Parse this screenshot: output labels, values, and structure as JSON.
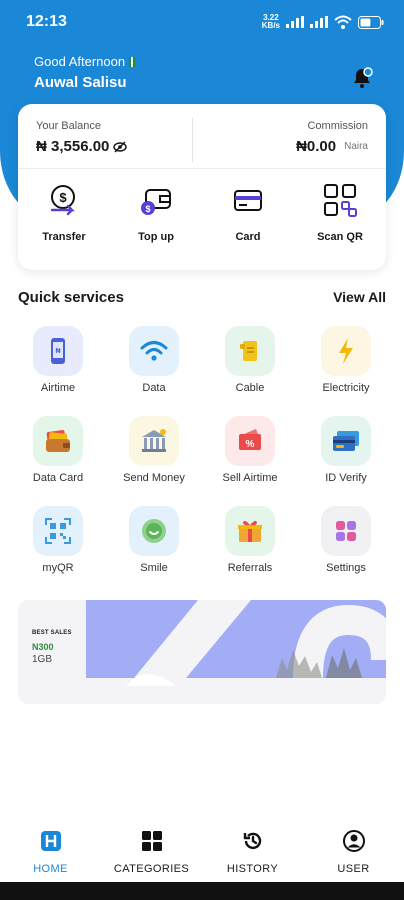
{
  "status_bar": {
    "time": "12:13",
    "net_speed_value": "3.22",
    "net_speed_unit": "KB/s",
    "battery_level": 0.55
  },
  "header": {
    "greeting": "Good Afternoon",
    "username": "Auwal Salisu",
    "accent_color": "#1a88d6"
  },
  "balance_card": {
    "balance_label": "Your Balance",
    "balance_value": "₦ 3,556.00",
    "commission_label": "Commission",
    "commission_value": "₦0.00",
    "commission_unit": "Naira"
  },
  "actions": [
    {
      "label": "Transfer",
      "icon": "transfer-icon"
    },
    {
      "label": "Top up",
      "icon": "wallet-icon"
    },
    {
      "label": "Card",
      "icon": "credit-card-icon"
    },
    {
      "label": "Scan QR",
      "icon": "scan-qr-icon"
    }
  ],
  "quick_services": {
    "title": "Quick services",
    "view_all": "View All",
    "items": [
      {
        "label": "Airtime",
        "icon": "phone-icon"
      },
      {
        "label": "Data",
        "icon": "wifi-icon"
      },
      {
        "label": "Cable",
        "icon": "cable-icon"
      },
      {
        "label": "Electricity",
        "icon": "lightning-icon"
      },
      {
        "label": "Data Card",
        "icon": "wallet-cards-icon"
      },
      {
        "label": "Send Money",
        "icon": "bank-icon"
      },
      {
        "label": "Sell Airtime",
        "icon": "discount-tag-icon"
      },
      {
        "label": "ID Verify",
        "icon": "id-card-icon"
      },
      {
        "label": "myQR",
        "icon": "qr-code-icon"
      },
      {
        "label": "Smile",
        "icon": "smile-icon"
      },
      {
        "label": "Referrals",
        "icon": "gift-icon"
      },
      {
        "label": "Settings",
        "icon": "settings-grid-icon"
      }
    ]
  },
  "banner": {
    "tag": "BEST SALES",
    "price": "N300",
    "size": "1GB"
  },
  "bottom_nav": [
    {
      "label": "HOME",
      "icon": "home-icon",
      "active": true
    },
    {
      "label": "CATEGORIES",
      "icon": "categories-icon",
      "active": false
    },
    {
      "label": "HISTORY",
      "icon": "history-icon",
      "active": false
    },
    {
      "label": "USER",
      "icon": "user-icon",
      "active": false
    }
  ]
}
